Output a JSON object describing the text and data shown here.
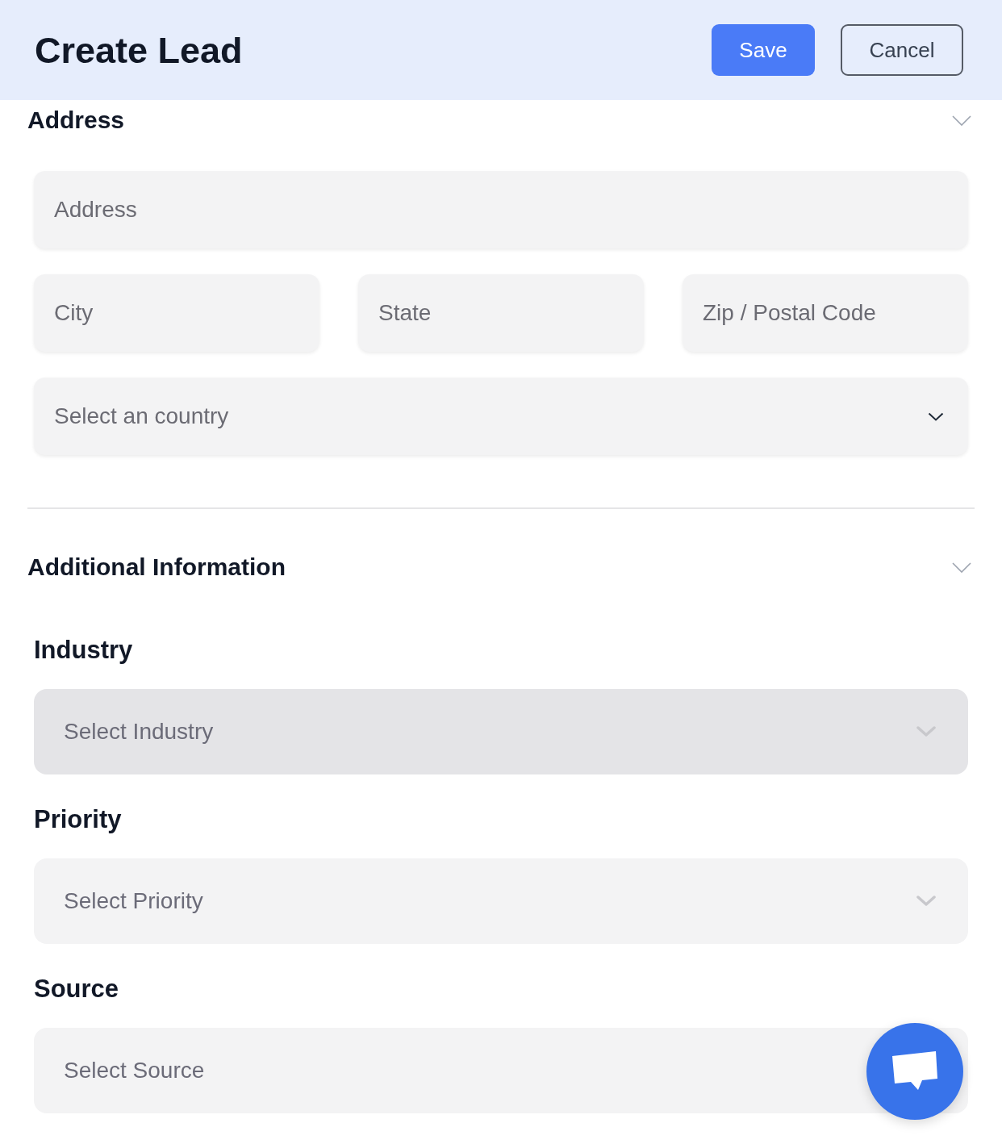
{
  "header": {
    "title": "Create Lead",
    "buttons": [
      {
        "label": "Save",
        "kind": "primary"
      },
      {
        "label": "Cancel",
        "kind": "secondary"
      }
    ]
  },
  "address_section": {
    "title": "Address",
    "rows": [
      [
        {
          "placeholder": "Address",
          "kind": "text"
        }
      ],
      [
        {
          "placeholder": "City",
          "kind": "text"
        },
        {
          "placeholder": "State",
          "kind": "text"
        },
        {
          "placeholder": "Zip / Postal Code",
          "kind": "text"
        }
      ],
      [
        {
          "placeholder": "Select an country",
          "kind": "select"
        }
      ]
    ]
  },
  "additional_section": {
    "title": "Additional Information",
    "fields": [
      {
        "label": "Industry",
        "placeholder": "Select Industry",
        "hovered": true
      },
      {
        "label": "Priority",
        "placeholder": "Select Priority",
        "hovered": false
      },
      {
        "label": "Source",
        "placeholder": "Select Source",
        "hovered": false
      }
    ]
  }
}
